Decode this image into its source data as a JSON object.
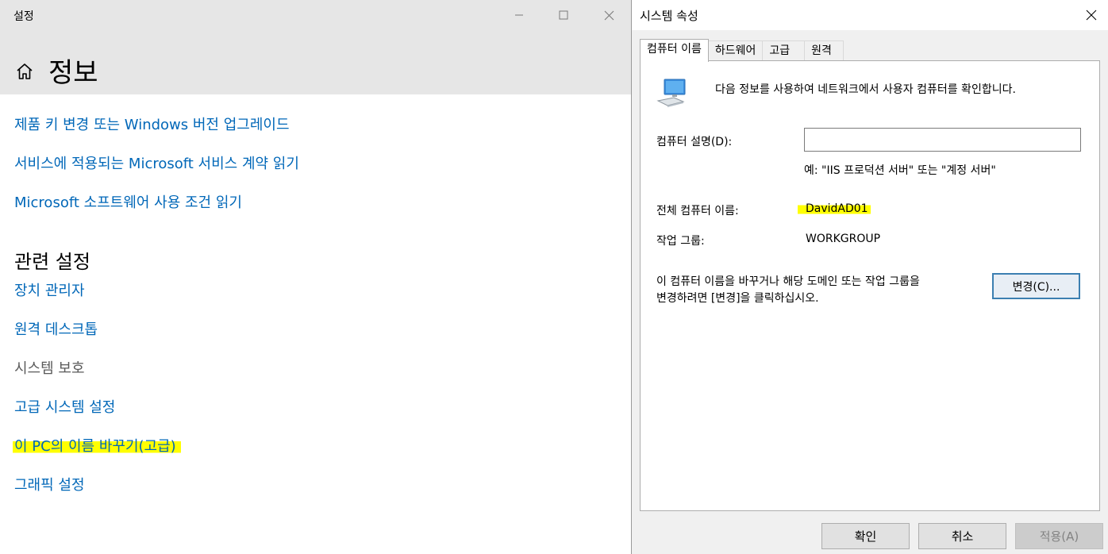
{
  "settings": {
    "app_title": "설정",
    "page_title": "정보",
    "links": {
      "product_key": "제품 키 변경 또는 Windows 버전 업그레이드",
      "service_agreement": "서비스에 적용되는 Microsoft 서비스 계약 읽기",
      "license_terms": "Microsoft 소프트웨어 사용 조건 읽기"
    },
    "related_title": "관련 설정",
    "related": {
      "device_manager": "장치 관리자",
      "remote_desktop": "원격 데스크톱",
      "system_protection": "시스템 보호",
      "advanced_system": "고급 시스템 설정",
      "rename_pc": "이 PC의 이름 바꾸기(고급)",
      "graphics": "그래픽 설정"
    }
  },
  "dialog": {
    "title": "시스템 속성",
    "tabs": [
      "컴퓨터 이름",
      "하드웨어",
      "고급",
      "원격"
    ],
    "info_text": "다음 정보를 사용하여 네트워크에서 사용자 컴퓨터를 확인합니다.",
    "description_label": "컴퓨터 설명(D):",
    "description_value": "",
    "description_example": "예: \"IIS 프로덕션 서버\" 또는 \"계정 서버\"",
    "full_name_label": "전체 컴퓨터 이름:",
    "full_name_value": "DavidAD01",
    "workgroup_label": "작업 그룹:",
    "workgroup_value": "WORKGROUP",
    "change_text_line1": "이 컴퓨터 이름을 바꾸거나 해당 도메인 또는 작업 그룹을",
    "change_text_line2": "변경하려면 [변경]을 클릭하십시오.",
    "change_button": "변경(C)...",
    "ok_button": "확인",
    "cancel_button": "취소",
    "apply_button": "적용(A)"
  },
  "colors": {
    "link": "#0067b8",
    "highlight": "#ffff00",
    "header_bg": "#e6e6e6",
    "dialog_bg": "#f0f0f0"
  },
  "icons": [
    "home-icon",
    "minimize-icon",
    "maximize-icon",
    "close-icon",
    "computer-icon"
  ]
}
